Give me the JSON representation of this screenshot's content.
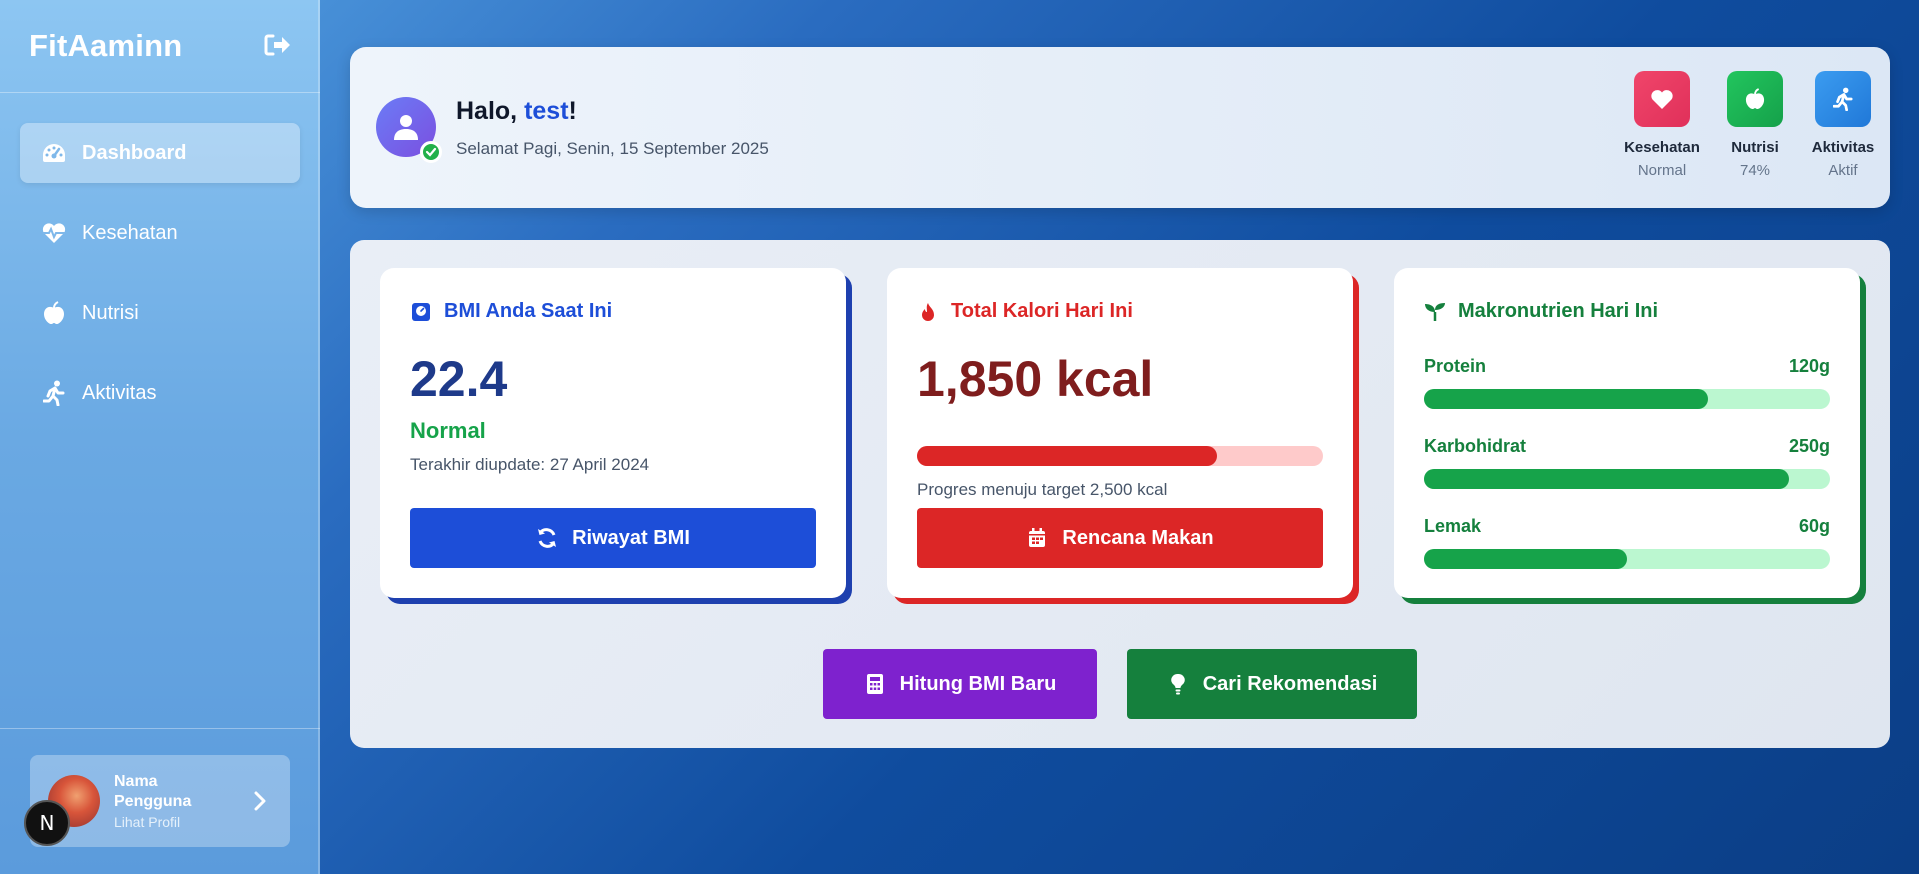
{
  "sidebar": {
    "brand": "FitAaminn",
    "items": [
      {
        "label": "Dashboard",
        "icon": "gauge-icon",
        "active": true
      },
      {
        "label": "Kesehatan",
        "icon": "heart-pulse-icon",
        "active": false
      },
      {
        "label": "Nutrisi",
        "icon": "apple-icon",
        "active": false
      },
      {
        "label": "Aktivitas",
        "icon": "running-icon",
        "active": false
      }
    ],
    "profile": {
      "name": "Nama Pengguna",
      "link": "Lihat Profil"
    },
    "badge": "N"
  },
  "header": {
    "greeting_prefix": "Halo, ",
    "username": "test",
    "greeting_suffix": "!",
    "subtitle": "Selamat Pagi, Senin, 15 September 2025",
    "status": [
      {
        "label": "Kesehatan",
        "value": "Normal",
        "icon": "heart-icon",
        "color": "#ee3a63"
      },
      {
        "label": "Nutrisi",
        "value": "74%",
        "icon": "apple-icon",
        "color": "#1aae4a"
      },
      {
        "label": "Aktivitas",
        "value": "Aktif",
        "icon": "running-icon",
        "color": "#2f8ae6"
      }
    ]
  },
  "bmi_card": {
    "title": "BMI Anda Saat Ini",
    "value": "22.4",
    "category": "Normal",
    "updated": "Terakhir diupdate: 27 April 2024",
    "button": "Riwayat BMI",
    "accent": "#1e40af"
  },
  "calorie_card": {
    "title": "Total Kalori Hari Ini",
    "value": "1,850 kcal",
    "progress_fraction": 0.74,
    "progress_text": "Progres menuju target 2,500 kcal",
    "button": "Rencana Makan",
    "accent": "#dc2626"
  },
  "macro_card": {
    "title": "Makronutrien Hari Ini",
    "accent": "#15803d",
    "items": [
      {
        "label": "Protein",
        "value": "120g",
        "fraction": 0.7
      },
      {
        "label": "Karbohidrat",
        "value": "250g",
        "fraction": 0.9
      },
      {
        "label": "Lemak",
        "value": "60g",
        "fraction": 0.5
      }
    ]
  },
  "actions": {
    "bmi_button": "Hitung BMI Baru",
    "recommend_button": "Cari Rekomendasi"
  }
}
